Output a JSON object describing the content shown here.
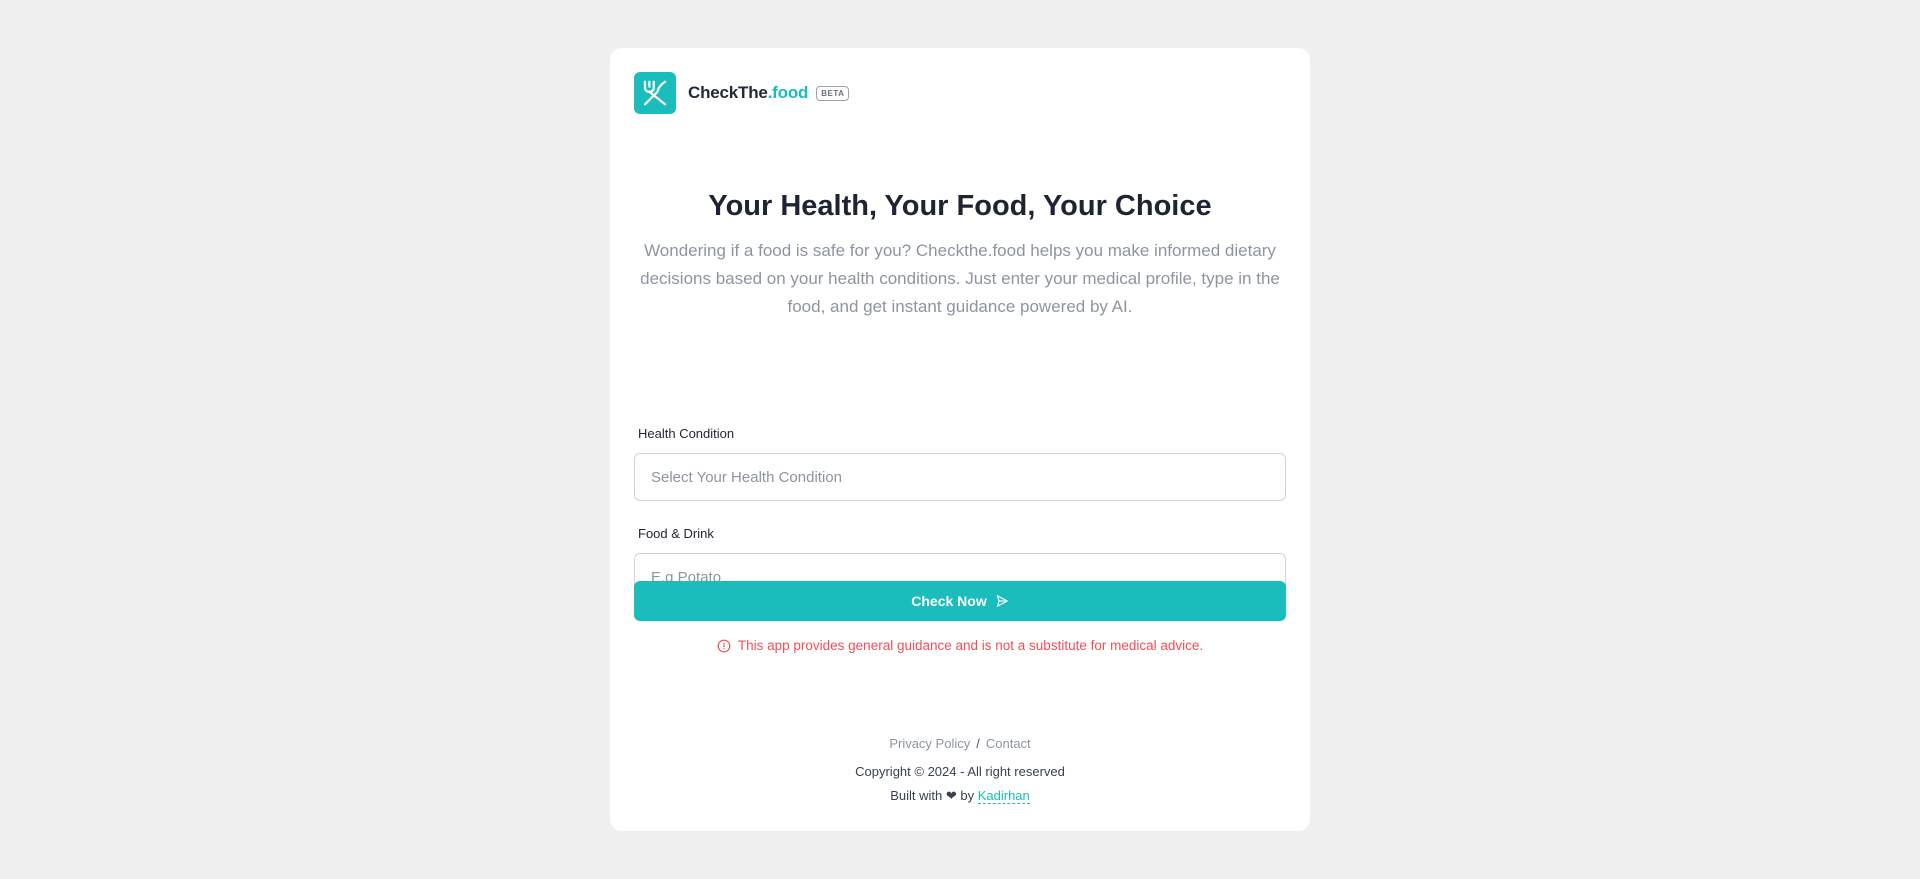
{
  "brand": {
    "name_main": "CheckThe",
    "name_accent": ".food",
    "badge": "BETA",
    "logo_icon": "fork-knife-icon",
    "accent_color": "#1abdbb"
  },
  "hero": {
    "title": "Your Health, Your Food, Your Choice",
    "description": "Wondering if a food is safe for you? Checkthe.food helps you make informed dietary decisions based on your health conditions. Just enter your medical profile, type in the food, and get instant guidance powered by AI."
  },
  "form": {
    "condition_label": "Health Condition",
    "condition_placeholder": "Select Your Health Condition",
    "food_label": "Food & Drink",
    "food_placeholder": "E.g Potato",
    "submit_label": "Check Now",
    "submit_icon": "send-icon"
  },
  "disclaimer": {
    "icon": "info-circle-icon",
    "text": "This app provides general guidance and is not a substitute for medical advice.",
    "color": "#ef4f55"
  },
  "footer": {
    "privacy_label": "Privacy Policy",
    "separator": "/",
    "contact_label": "Contact",
    "copyright": "Copyright © 2024 - All right reserved",
    "built_prefix": "Built with ❤ by",
    "author": "Kadirhan"
  }
}
